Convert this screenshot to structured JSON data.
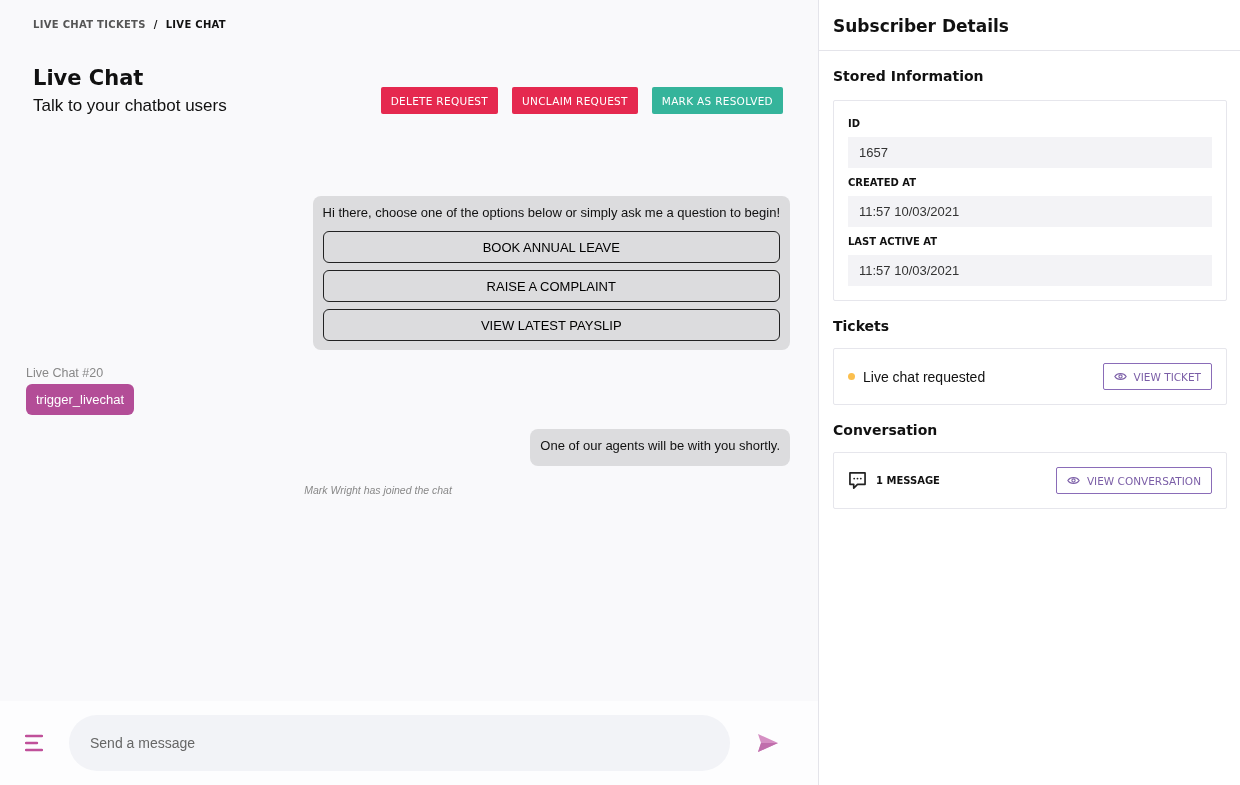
{
  "breadcrumb": [
    {
      "label": "LIVE CHAT TICKETS",
      "current": false
    },
    {
      "label": "LIVE CHAT",
      "current": true
    }
  ],
  "breadcrumb_separator": "/",
  "header": {
    "title": "Live Chat",
    "subtitle": "Talk to your chatbot users"
  },
  "actions": [
    {
      "label": "DELETE REQUEST",
      "kind": "danger"
    },
    {
      "label": "UNCLAIM REQUEST",
      "kind": "danger"
    },
    {
      "label": "MARK AS RESOLVED",
      "kind": "success"
    }
  ],
  "messages": [
    {
      "kind": "bot",
      "text": "Hi there, choose one of the options below or simply ask me a question to begin!",
      "options": [
        "BOOK ANNUAL LEAVE",
        "RAISE A COMPLAINT",
        "VIEW LATEST PAYSLIP"
      ]
    },
    {
      "kind": "user",
      "label": "Live Chat #20",
      "text": "trigger_livechat"
    },
    {
      "kind": "bot",
      "text": "One of our agents will be with you shortly."
    },
    {
      "kind": "system",
      "text": "Mark Wright has joined the chat"
    }
  ],
  "composer": {
    "placeholder": "Send a message"
  },
  "panel": {
    "title": "Subscriber Details",
    "stored_title": "Stored Information",
    "fields": [
      {
        "label": "ID",
        "value": "1657"
      },
      {
        "label": "CREATED AT",
        "value": "11:57 10/03/2021"
      },
      {
        "label": "LAST ACTIVE AT",
        "value": "11:57 10/03/2021"
      }
    ],
    "tickets_title": "Tickets",
    "tickets": [
      {
        "status": "Live chat requested",
        "color": "#fbbf4e",
        "button": "VIEW TICKET"
      }
    ],
    "conversation_title": "Conversation",
    "conversation": {
      "count": "1 MESSAGE",
      "button": "VIEW CONVERSATION"
    }
  }
}
